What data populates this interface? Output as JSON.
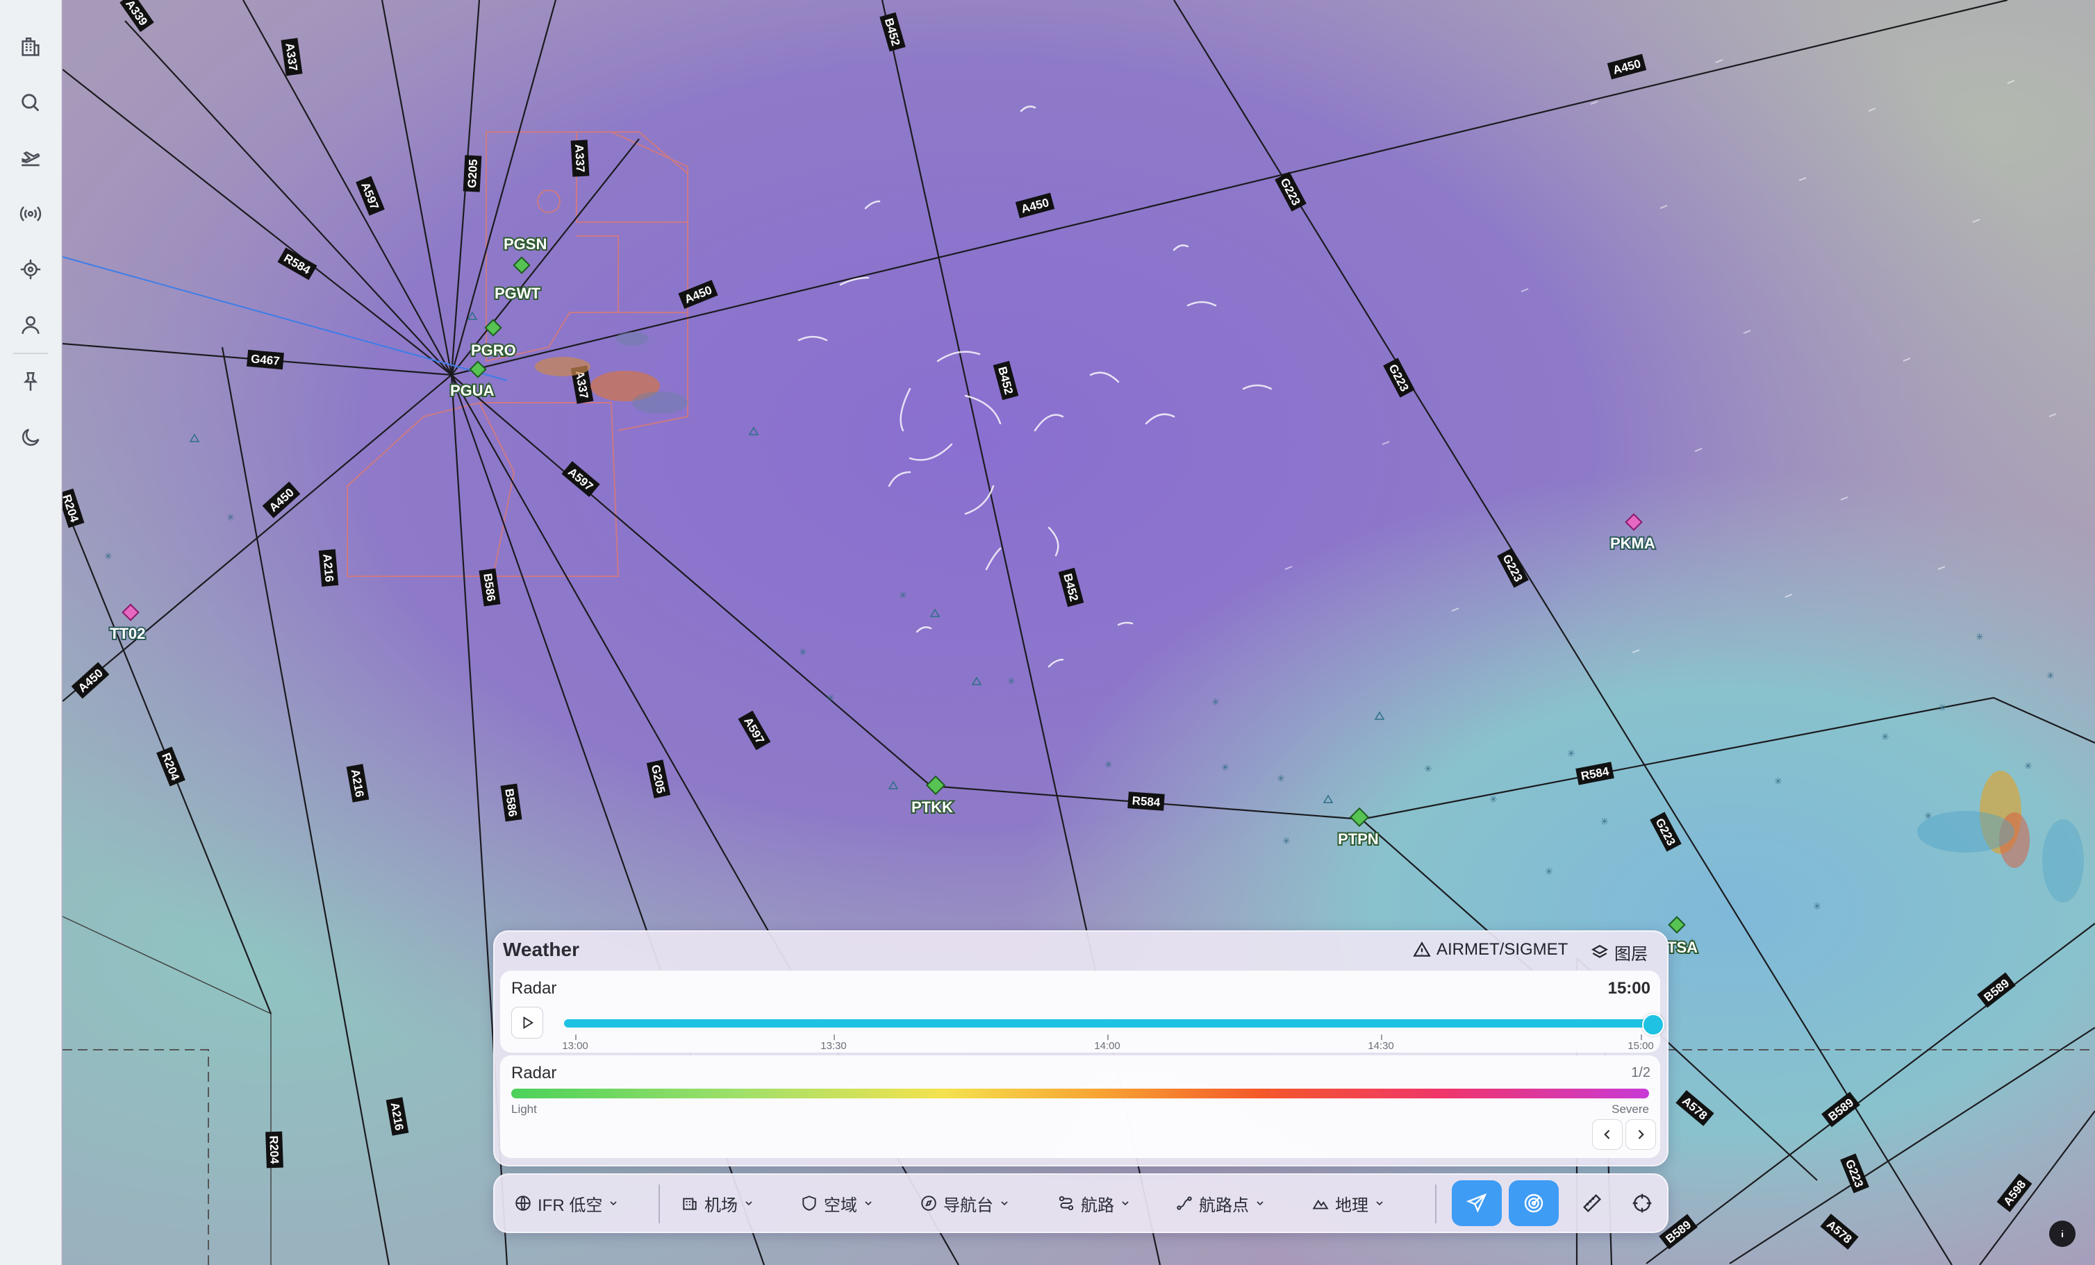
{
  "sidebar": {
    "icons": [
      "building-icon",
      "search-icon",
      "airplane-takeoff-icon",
      "broadcast-icon",
      "crosshair-icon",
      "user-icon",
      "pin-icon",
      "moon-icon"
    ]
  },
  "map": {
    "airports": [
      {
        "name": "PGSN",
        "type": "airport"
      },
      {
        "name": "PGWT",
        "type": "airport"
      },
      {
        "name": "PGRO",
        "type": "airport"
      },
      {
        "name": "PGUA",
        "type": "airport"
      },
      {
        "name": "PTKK",
        "type": "airport"
      },
      {
        "name": "PTPN",
        "type": "airport"
      },
      {
        "name": "TSA",
        "type": "airport"
      },
      {
        "name": "PKMA",
        "type": "heliport"
      },
      {
        "name": "TT02",
        "type": "heliport"
      }
    ],
    "airways": [
      "A339",
      "B452",
      "A337",
      "G205",
      "A597",
      "R584",
      "A450",
      "G467",
      "A216",
      "R204",
      "B586",
      "G223",
      "B589",
      "A578",
      "A598"
    ]
  },
  "weather": {
    "title": "Weather",
    "airmet_label": "AIRMET/SIGMET",
    "layers_label": "图层",
    "radar_label": "Radar",
    "current_time": "15:00",
    "ticks": [
      "13:00",
      "13:30",
      "14:00",
      "14:30",
      "15:00"
    ],
    "progress": 1.0,
    "legend": {
      "title": "Radar",
      "page": "1/2",
      "low_label": "Light",
      "high_label": "Severe"
    }
  },
  "toolbar": {
    "ifr_label": "IFR 低空",
    "airport_label": "机场",
    "airspace_label": "空域",
    "navaid_label": "导航台",
    "route_label": "航路",
    "waypoint_label": "航路点",
    "geo_label": "地理"
  },
  "colors": {
    "accent": "#1fc2e2",
    "active_button": "#3e9cf5",
    "airport_green": "#36a33a",
    "heliport_magenta": "#cf2f9c"
  }
}
